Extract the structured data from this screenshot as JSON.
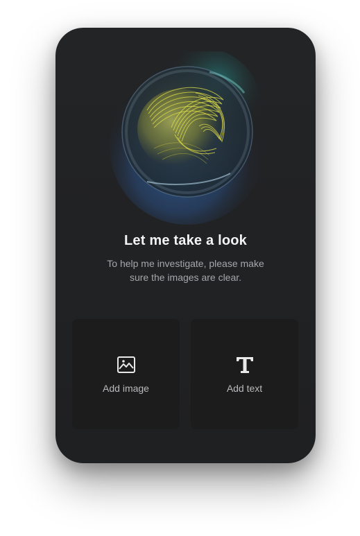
{
  "assistant": {
    "heading": "Let me take a look",
    "description": "To help me investigate, please make sure the images are clear."
  },
  "actions": [
    {
      "label": "Add image",
      "icon": "image-icon"
    },
    {
      "label": "Add text",
      "icon": "text-icon"
    }
  ],
  "colors": {
    "card_background": "#232426",
    "tile_background": "#1c1c1d",
    "heading_text": "#f4f4f5",
    "body_text": "#a6a7aa",
    "orb_glow_blue": "#3a7bd5",
    "orb_glow_teal": "#2bb3b1",
    "orb_ribbon_yellow": "#e3e04a"
  }
}
